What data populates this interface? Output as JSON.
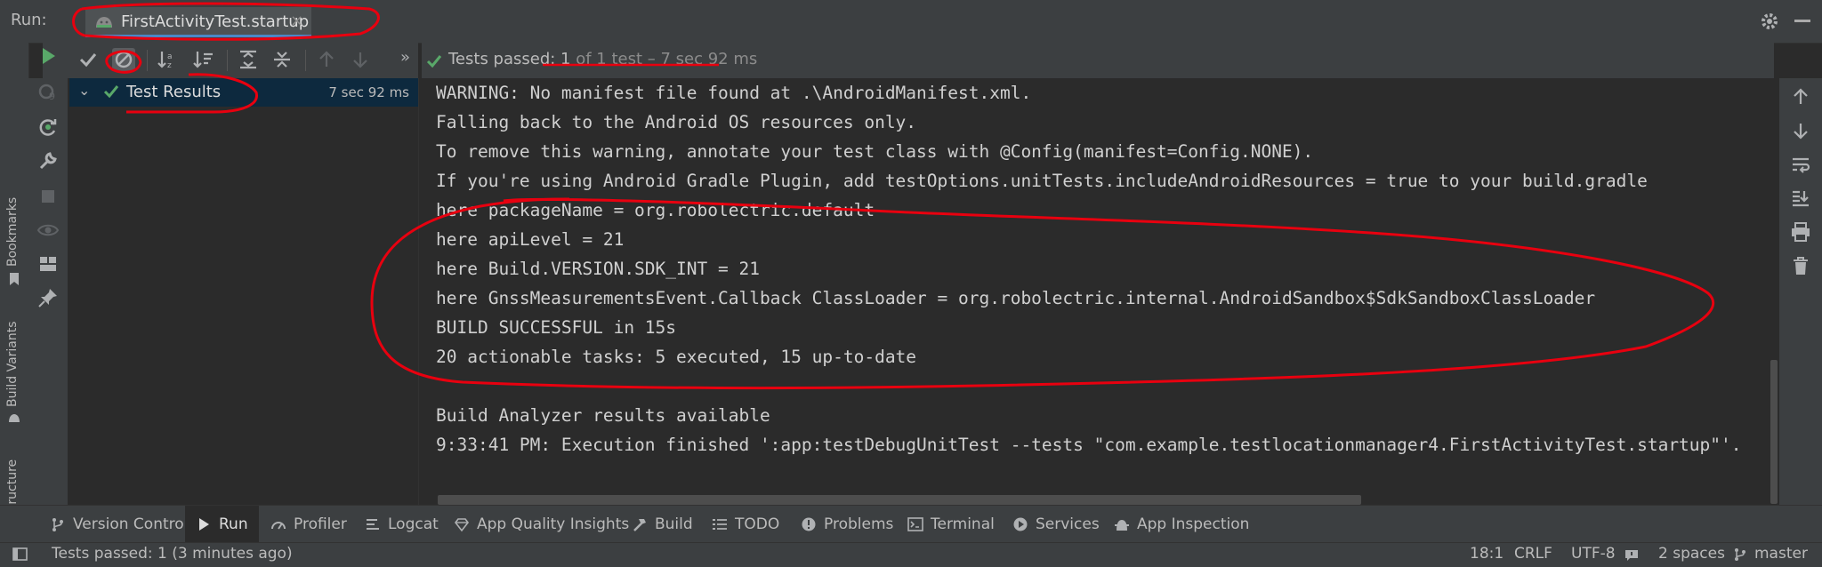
{
  "header": {
    "run_label": "Run:",
    "tab_label": "FirstActivityTest.startup",
    "tab_close": "×"
  },
  "toolbar": {
    "more": "»",
    "status_prefix": "Tests passed: ",
    "status_count": "1",
    "status_detail": " of 1 test – 7 sec 92 ms"
  },
  "left_strip": {
    "bookmarks": "Bookmarks",
    "build_variants": "Build Variants",
    "structure": "Structure"
  },
  "tree": {
    "chevron": "⌄",
    "label": "Test Results",
    "time": "7 sec 92 ms"
  },
  "console": {
    "lines": [
      "WARNING: No manifest file found at .\\AndroidManifest.xml.",
      "Falling back to the Android OS resources only.",
      "To remove this warning, annotate your test class with @Config(manifest=Config.NONE).",
      "If you're using Android Gradle Plugin, add testOptions.unitTests.includeAndroidResources = true to your build.gradle",
      "here packageName = org.robolectric.default",
      "here apiLevel = 21",
      "here Build.VERSION.SDK_INT = 21",
      "here GnssMeasurementsEvent.Callback ClassLoader = org.robolectric.internal.AndroidSandbox$SdkSandboxClassLoader",
      "BUILD SUCCESSFUL in 15s",
      "20 actionable tasks: 5 executed, 15 up-to-date",
      "",
      "Build Analyzer results available",
      "9:33:41 PM: Execution finished ':app:testDebugUnitTest --tests \"com.example.testlocationmanager4.FirstActivityTest.startup\"'."
    ]
  },
  "bottom_tabs": [
    {
      "label": "Version Control",
      "icon": "branch-icon"
    },
    {
      "label": "Run",
      "icon": "play-icon"
    },
    {
      "label": "Profiler",
      "icon": "gauge-icon"
    },
    {
      "label": "Logcat",
      "icon": "list-icon"
    },
    {
      "label": "App Quality Insights",
      "icon": "diamond-icon"
    },
    {
      "label": "Build",
      "icon": "hammer-icon"
    },
    {
      "label": "TODO",
      "icon": "todo-list-icon"
    },
    {
      "label": "Problems",
      "icon": "warning-circle-icon"
    },
    {
      "label": "Terminal",
      "icon": "terminal-icon"
    },
    {
      "label": "Services",
      "icon": "services-icon"
    },
    {
      "label": "App Inspection",
      "icon": "inspection-icon"
    }
  ],
  "statusbar": {
    "message": "Tests passed: 1 (3 minutes ago)",
    "position": "18:1",
    "line_sep": "CRLF",
    "encoding": "UTF-8",
    "indent": "2 spaces",
    "branch": "master"
  },
  "colors": {
    "pass_green": "#59a869",
    "annotation_red": "#e8000f",
    "selection": "#0d293e",
    "panel": "#3c3f41",
    "editor_bg": "#2b2b2b"
  }
}
